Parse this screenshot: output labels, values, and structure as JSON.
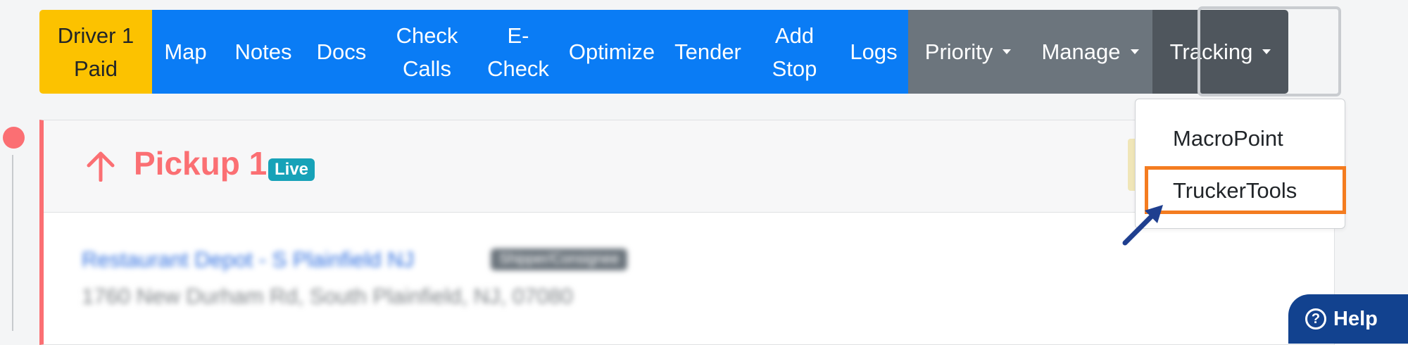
{
  "toolbar": {
    "status_button": "Driver 1\nPaid",
    "buttons": [
      "Map",
      "Notes",
      "Docs",
      "Check\nCalls",
      "E-\nCheck",
      "Optimize",
      "Tender",
      "Add\nStop",
      "Logs"
    ],
    "dropdowns": [
      "Priority",
      "Manage",
      "Tracking"
    ]
  },
  "stop": {
    "title": "Pickup 1",
    "badge": "Live",
    "location_name": "Restaurant Depot - S Plainfield NJ",
    "location_tag": "Shipper/Consignee",
    "address": "1760 New Durham Rd, South Plainfield, NJ, 07080"
  },
  "tracking_menu": {
    "items": [
      "MacroPoint",
      "TruckerTools"
    ]
  },
  "help": {
    "icon": "?",
    "label": "Help"
  },
  "colors": {
    "primary": "#0a7cf5",
    "warning": "#fcc200",
    "secondary": "#6c757d",
    "pickup_accent": "#fb6f73",
    "live_badge": "#17a2b8",
    "highlight": "#f47c20",
    "pointer_arrow": "#1f3f8f",
    "help_button": "#12428f"
  },
  "icons": {
    "pickup": "arrow-up-icon",
    "pointer": "pointer-arrow-icon",
    "help": "question-circle-icon",
    "dropdown": "caret-down-icon"
  }
}
